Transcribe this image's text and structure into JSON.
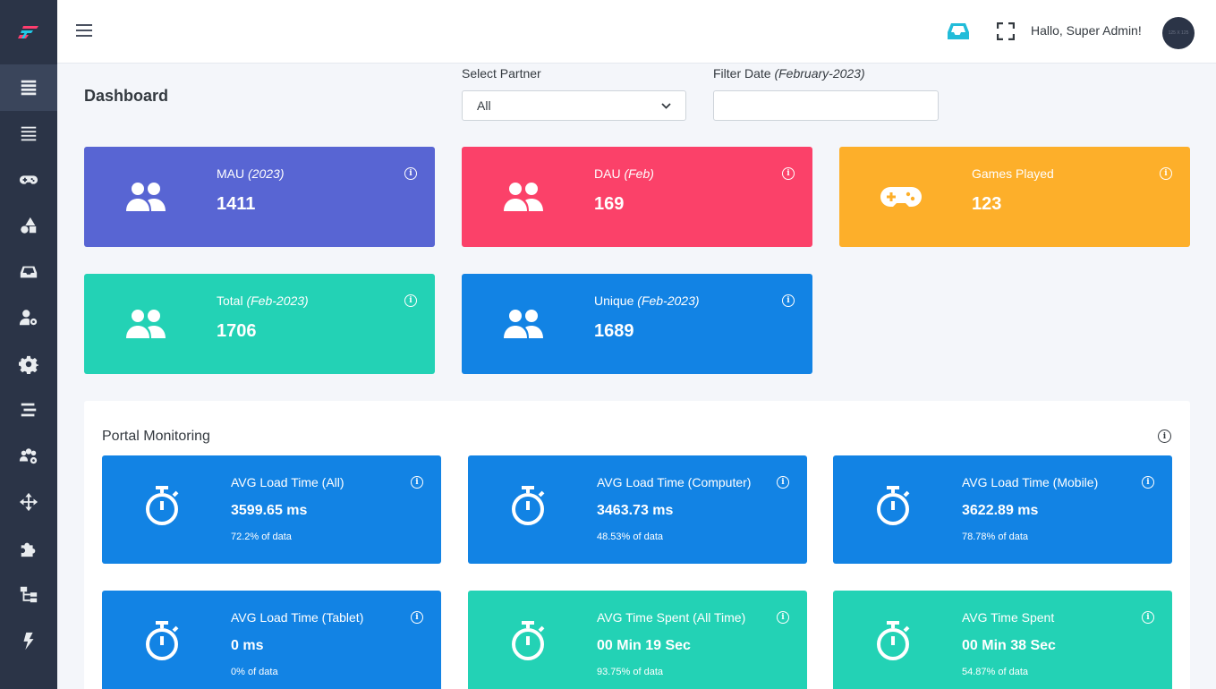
{
  "colors": {
    "sidebar": "#2b3447",
    "indigo": "#5865d3",
    "pink": "#fb4169",
    "amber": "#fdaf2a",
    "teal": "#23d2b5",
    "blue": "#1283e4"
  },
  "sidebar": {
    "items": [
      {
        "icon": "list-icon",
        "active": true
      },
      {
        "icon": "list-alt-icon"
      },
      {
        "icon": "gamepad-icon"
      },
      {
        "icon": "shapes-icon"
      },
      {
        "icon": "inbox-icon"
      },
      {
        "icon": "user-cog-icon"
      },
      {
        "icon": "gear-icon"
      },
      {
        "icon": "stream-icon"
      },
      {
        "icon": "users-cog-icon"
      },
      {
        "icon": "arrows-icon"
      },
      {
        "icon": "puzzle-icon"
      },
      {
        "icon": "sitemap-icon"
      },
      {
        "icon": "bolt-icon"
      }
    ]
  },
  "header": {
    "greeting": "Hallo, Super Admin!",
    "avatar_text": "125 X 125"
  },
  "page": {
    "title": "Dashboard",
    "partner_label": "Select Partner",
    "partner_value": "All",
    "date_label": "Filter Date",
    "date_hint": "(February-2023)",
    "date_value": ""
  },
  "stats": [
    {
      "label": "MAU",
      "qualifier": "(2023)",
      "value": "1411",
      "icon": "users-icon",
      "color": "#5865d3"
    },
    {
      "label": "DAU",
      "qualifier": "(Feb)",
      "value": "169",
      "icon": "users-icon",
      "color": "#fb4169"
    },
    {
      "label": "Games Played",
      "qualifier": "",
      "value": "123",
      "icon": "gamepad-icon",
      "color": "#fdaf2a"
    },
    {
      "label": "Total",
      "qualifier": "(Feb-2023)",
      "value": "1706",
      "icon": "users-icon",
      "color": "#23d2b5"
    },
    {
      "label": "Unique",
      "qualifier": "(Feb-2023)",
      "value": "1689",
      "icon": "users-icon",
      "color": "#1283e4"
    }
  ],
  "portal": {
    "title": "Portal Monitoring",
    "cards": [
      {
        "label": "AVG Load Time (All)",
        "value": "3599.65 ms",
        "sub": "72.2% of data",
        "color": "#1283e4"
      },
      {
        "label": "AVG Load Time (Computer)",
        "value": "3463.73 ms",
        "sub": "48.53% of data",
        "color": "#1283e4"
      },
      {
        "label": "AVG Load Time (Mobile)",
        "value": "3622.89 ms",
        "sub": "78.78% of data",
        "color": "#1283e4"
      },
      {
        "label": "AVG Load Time (Tablet)",
        "value": "0 ms",
        "sub": "0% of data",
        "color": "#1283e4"
      },
      {
        "label": "AVG Time Spent (All Time)",
        "value": "00 Min 19 Sec",
        "sub": "93.75% of data",
        "color": "#23d2b5"
      },
      {
        "label": "AVG Time Spent",
        "value": "00 Min 38 Sec",
        "sub": "54.87% of data",
        "color": "#23d2b5"
      }
    ]
  }
}
